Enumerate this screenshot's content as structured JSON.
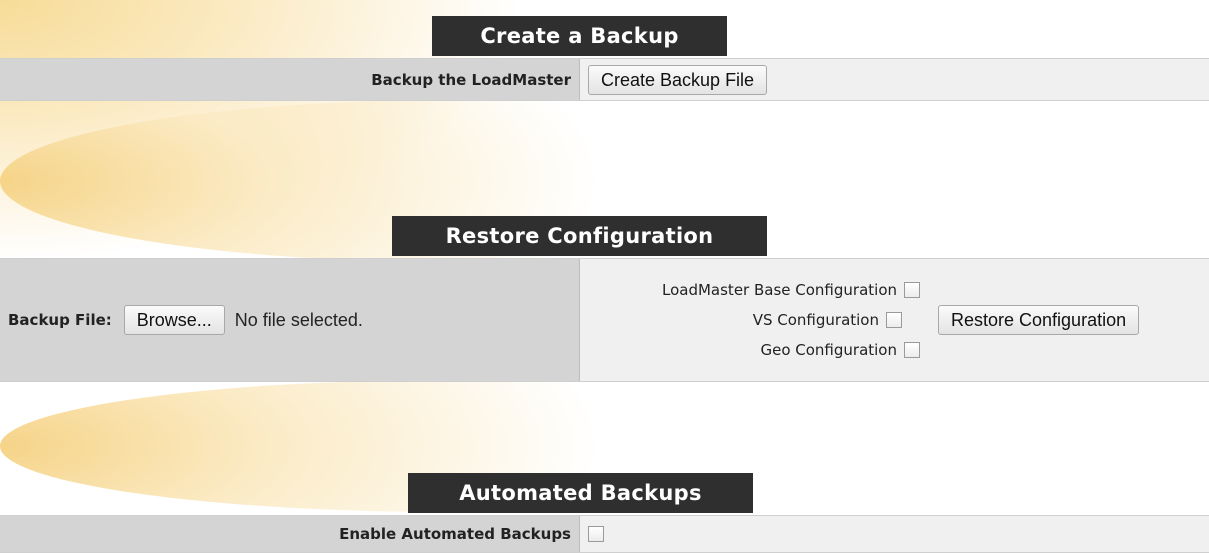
{
  "create_backup": {
    "title": "Create a Backup",
    "row_label": "Backup the LoadMaster",
    "button_label": "Create Backup File"
  },
  "restore": {
    "title": "Restore Configuration",
    "file_label": "Backup File:",
    "browse_label": "Browse...",
    "file_status": "No file selected.",
    "options": [
      {
        "label": "LoadMaster Base Configuration",
        "checked": false
      },
      {
        "label": "VS Configuration",
        "checked": false
      },
      {
        "label": "Geo Configuration",
        "checked": false
      }
    ],
    "button_label": "Restore Configuration"
  },
  "automated": {
    "title": "Automated Backups",
    "row_label": "Enable Automated Backups",
    "checked": false
  }
}
